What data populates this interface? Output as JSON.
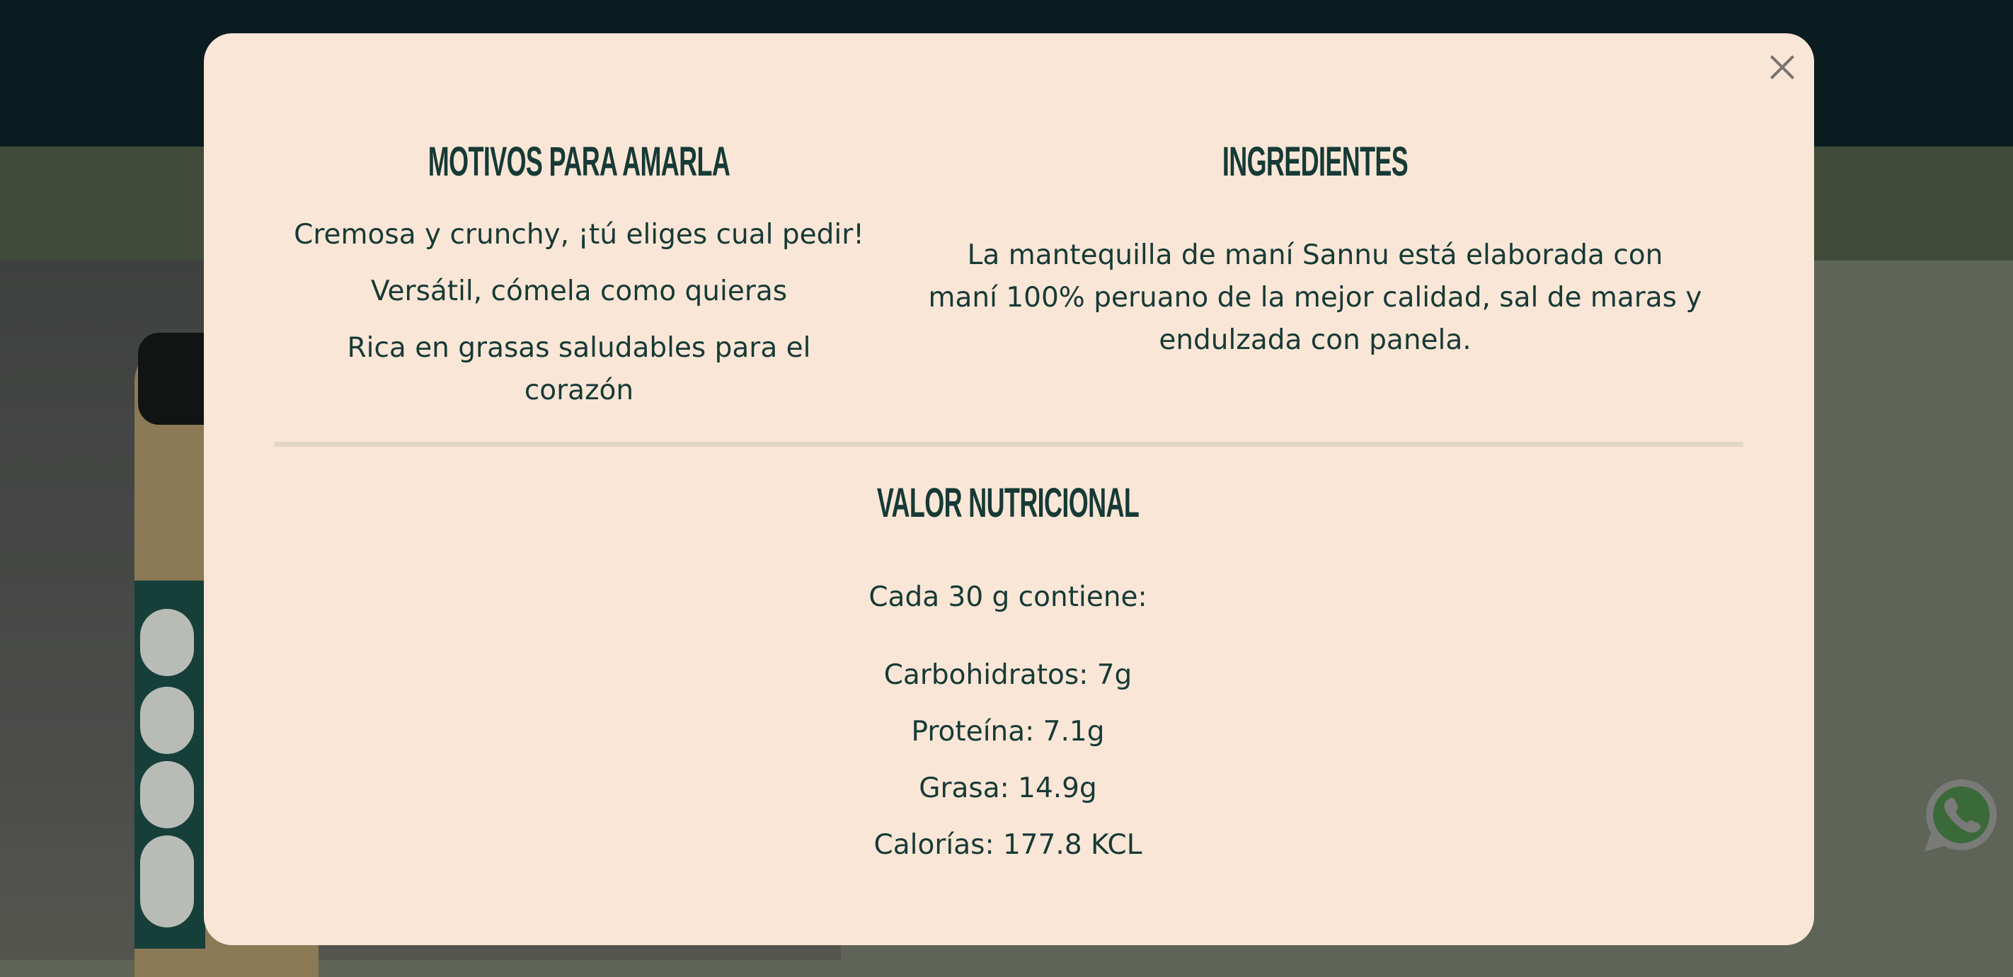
{
  "modal": {
    "close_icon": "close-icon",
    "reasons": {
      "title": "MOTIVOS PARA AMARLA",
      "items": [
        "Cremosa y crunchy, ¡tú eliges cual pedir!",
        "Versátil, cómela como quieras",
        "Rica en grasas saludables para el corazón"
      ]
    },
    "ingredients": {
      "title": "INGREDIENTES",
      "text_lines": [
        "La mantequilla de maní Sannu está elaborada con",
        "maní 100% peruano de la mejor calidad, sal de maras y",
        "endulzada con panela."
      ]
    },
    "nutrition": {
      "title": "VALOR NUTRICIONAL",
      "serving": "Cada 30 g contiene:",
      "items": [
        "Carbohidratos: 7g",
        "Proteína: 7.1g",
        "Grasa: 14.9g",
        "Calorías: 177.8 KCL"
      ]
    }
  },
  "colors": {
    "text": "#163a36",
    "modal_bg": "#fae6d6",
    "whatsapp": "#3b6a3a"
  },
  "floating": {
    "whatsapp_icon": "whatsapp-icon"
  }
}
